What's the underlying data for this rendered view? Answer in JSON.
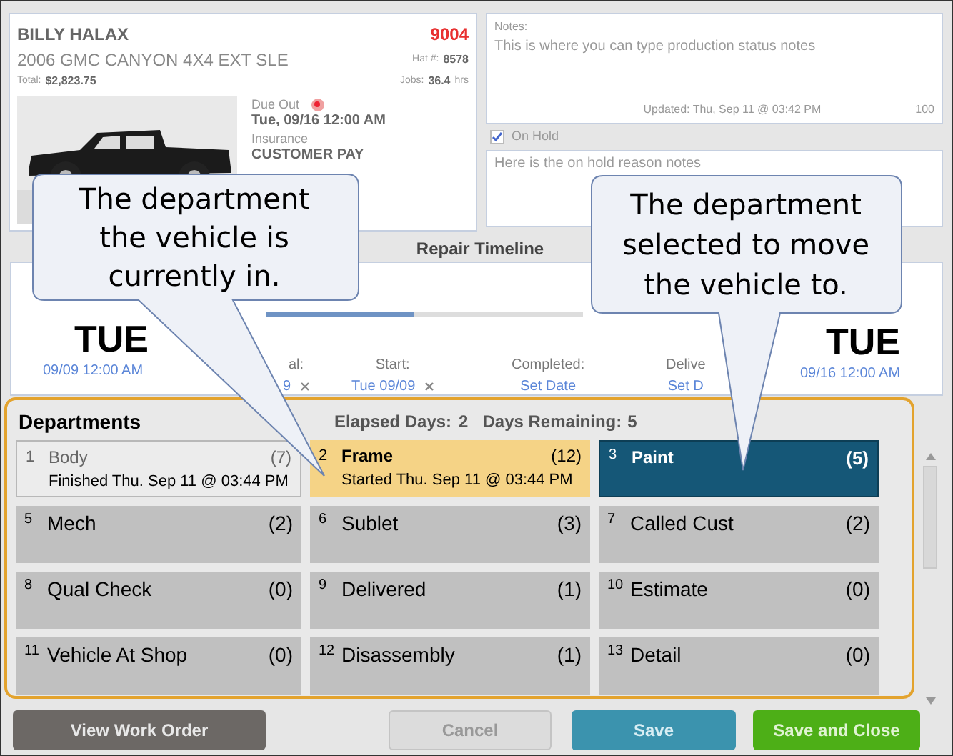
{
  "customer": {
    "name": "BILLY HALAX",
    "vehicle": "2006 GMC CANYON 4X4 EXT SLE",
    "total_label": "Total:",
    "total": "$2,823.75",
    "ro_number": "9004",
    "hat_label": "Hat #:",
    "hat": "8578",
    "jobs_label": "Jobs:",
    "jobs": "36.4",
    "jobs_unit": "hrs",
    "due_out_label": "Due Out",
    "due_out": "Tue, 09/16 12:00 AM",
    "insurance_label": "Insurance",
    "insurance": "CUSTOMER PAY"
  },
  "notes": {
    "label": "Notes:",
    "text": "This is where you can type production status notes",
    "updated": "Updated: Thu, Sep 11 @ 03:42 PM",
    "count": "100"
  },
  "on_hold": {
    "label": "On Hold",
    "checked": true,
    "notes": "Here is the on hold reason notes"
  },
  "timeline": {
    "title": "Repair Timeline",
    "left_day": "TUE",
    "left_date": "09/09 12:00 AM",
    "right_day": "TUE",
    "right_date": "09/16 12:00 AM",
    "level": 0.47,
    "stages": [
      {
        "label": "al:",
        "value": "9",
        "removable": true
      },
      {
        "label": "Start:",
        "value": "Tue 09/09",
        "removable": true
      },
      {
        "label": "Completed:",
        "value": "Set Date",
        "removable": false
      },
      {
        "label": "Delive",
        "value": "Set D",
        "removable": false
      }
    ]
  },
  "departments": {
    "title": "Departments",
    "elapsed_label": "Elapsed Days:",
    "elapsed": "2",
    "remaining_label": "Days Remaining:",
    "remaining": "5",
    "items": [
      {
        "number": "1",
        "name": "Body",
        "count": "(7)",
        "kind": "finished",
        "note": "Finished Thu. Sep 11 @ 03:44 PM"
      },
      {
        "number": "2",
        "name": "Frame",
        "count": "(12)",
        "kind": "current",
        "note": "Started Thu. Sep 11 @ 03:44 PM"
      },
      {
        "number": "3",
        "name": "Paint",
        "count": "(5)",
        "kind": "selected"
      },
      {
        "number": "5",
        "name": "Mech",
        "count": "(2)",
        "kind": "normal"
      },
      {
        "number": "6",
        "name": "Sublet",
        "count": "(3)",
        "kind": "normal"
      },
      {
        "number": "7",
        "name": "Called Cust",
        "count": "(2)",
        "kind": "normal"
      },
      {
        "number": "8",
        "name": "Qual Check",
        "count": "(0)",
        "kind": "normal"
      },
      {
        "number": "9",
        "name": "Delivered",
        "count": "(1)",
        "kind": "normal"
      },
      {
        "number": "10",
        "name": "Estimate",
        "count": "(0)",
        "kind": "normal"
      },
      {
        "number": "11",
        "name": "Vehicle At Shop",
        "count": "(0)",
        "kind": "normal"
      },
      {
        "number": "12",
        "name": "Disassembly",
        "count": "(1)",
        "kind": "normal"
      },
      {
        "number": "13",
        "name": "Detail",
        "count": "(0)",
        "kind": "normal"
      }
    ]
  },
  "buttons": [
    {
      "label": "View Work Order",
      "kind": "dark"
    },
    {
      "label": "Cancel",
      "kind": "light"
    },
    {
      "label": "Save",
      "kind": "teal"
    },
    {
      "label": "Save and Close",
      "kind": "green"
    }
  ],
  "callouts": [
    {
      "text": "The department the vehicle is currently in."
    },
    {
      "text": "The department selected to move the vehicle to."
    }
  ]
}
